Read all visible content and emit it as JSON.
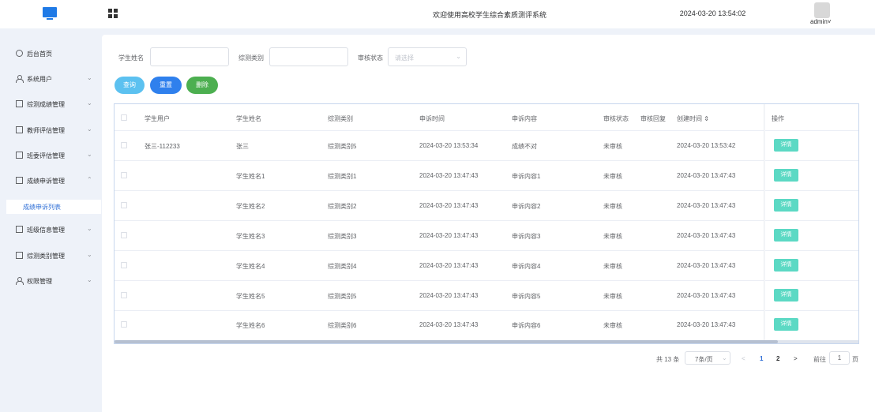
{
  "header": {
    "title": "欢迎使用高校学生综合素质测评系统",
    "datetime": "2024-03-20 13:54:02",
    "user": "admin",
    "user_chevron": "˅"
  },
  "sidebar": {
    "items": [
      {
        "label": "后台首页",
        "icon": "clock-icon",
        "chevron": ""
      },
      {
        "label": "系统用户",
        "icon": "person-icon",
        "chevron": "⌄"
      },
      {
        "label": "综测成绩管理",
        "icon": "card-icon",
        "chevron": "⌄"
      },
      {
        "label": "教师评估管理",
        "icon": "card-icon",
        "chevron": "⌄"
      },
      {
        "label": "班委评估管理",
        "icon": "card-icon",
        "chevron": "⌄"
      },
      {
        "label": "成绩申诉管理",
        "icon": "card-icon",
        "chevron": "⌃"
      },
      {
        "label": "班级信息管理",
        "icon": "card-icon",
        "chevron": "⌄"
      },
      {
        "label": "综测类别管理",
        "icon": "card-icon",
        "chevron": "⌄"
      },
      {
        "label": "权限管理",
        "icon": "person-icon",
        "chevron": "⌄"
      }
    ],
    "active_sub": "成绩申诉列表"
  },
  "filters": {
    "student_name_label": "学生姓名",
    "student_name_value": "",
    "category_label": "综测类别",
    "category_value": "",
    "status_label": "审核状态",
    "status_placeholder": "请选择",
    "status_arrow": "⌄"
  },
  "actions": {
    "query": "查询",
    "reset": "重置",
    "delete": "删除"
  },
  "colors": {
    "accent": "#2f6fd6",
    "query_btn": "#5cc1f0",
    "reset_btn": "#2f80ed",
    "delete_btn": "#4caf50",
    "detail_btn": "#5cd9c4"
  },
  "table": {
    "columns": [
      "学生用户",
      "学生姓名",
      "综测类别",
      "申诉时间",
      "申诉内容",
      "审核状态",
      "审核回复",
      "创建时间 ⇕",
      "操作"
    ],
    "rows": [
      {
        "user": "张三-112233",
        "name": "张三",
        "category": "综测类别5",
        "appeal_time": "2024-03-20 13:53:34",
        "content": "成绩不对",
        "status": "未审核",
        "reply": "",
        "created": "2024-03-20 13:53:42",
        "action": "详情"
      },
      {
        "user": "",
        "name": "学生姓名1",
        "category": "综测类别1",
        "appeal_time": "2024-03-20 13:47:43",
        "content": "申诉内容1",
        "status": "未审核",
        "reply": "",
        "created": "2024-03-20 13:47:43",
        "action": "详情"
      },
      {
        "user": "",
        "name": "学生姓名2",
        "category": "综测类别2",
        "appeal_time": "2024-03-20 13:47:43",
        "content": "申诉内容2",
        "status": "未审核",
        "reply": "",
        "created": "2024-03-20 13:47:43",
        "action": "详情"
      },
      {
        "user": "",
        "name": "学生姓名3",
        "category": "综测类别3",
        "appeal_time": "2024-03-20 13:47:43",
        "content": "申诉内容3",
        "status": "未审核",
        "reply": "",
        "created": "2024-03-20 13:47:43",
        "action": "详情"
      },
      {
        "user": "",
        "name": "学生姓名4",
        "category": "综测类别4",
        "appeal_time": "2024-03-20 13:47:43",
        "content": "申诉内容4",
        "status": "未审核",
        "reply": "",
        "created": "2024-03-20 13:47:43",
        "action": "详情"
      },
      {
        "user": "",
        "name": "学生姓名5",
        "category": "综测类别5",
        "appeal_time": "2024-03-20 13:47:43",
        "content": "申诉内容5",
        "status": "未审核",
        "reply": "",
        "created": "2024-03-20 13:47:43",
        "action": "详情"
      },
      {
        "user": "",
        "name": "学生姓名6",
        "category": "综测类别6",
        "appeal_time": "2024-03-20 13:47:43",
        "content": "申诉内容6",
        "status": "未审核",
        "reply": "",
        "created": "2024-03-20 13:47:43",
        "action": "详情"
      }
    ]
  },
  "pagination": {
    "total": "共 13 条",
    "page_size": "7条/页",
    "page_size_arrow": "⌄",
    "prev": "<",
    "pages": [
      "1",
      "2"
    ],
    "current": "1",
    "next": ">",
    "goto_label": "前往",
    "goto_value": "1",
    "goto_suffix": "页"
  }
}
